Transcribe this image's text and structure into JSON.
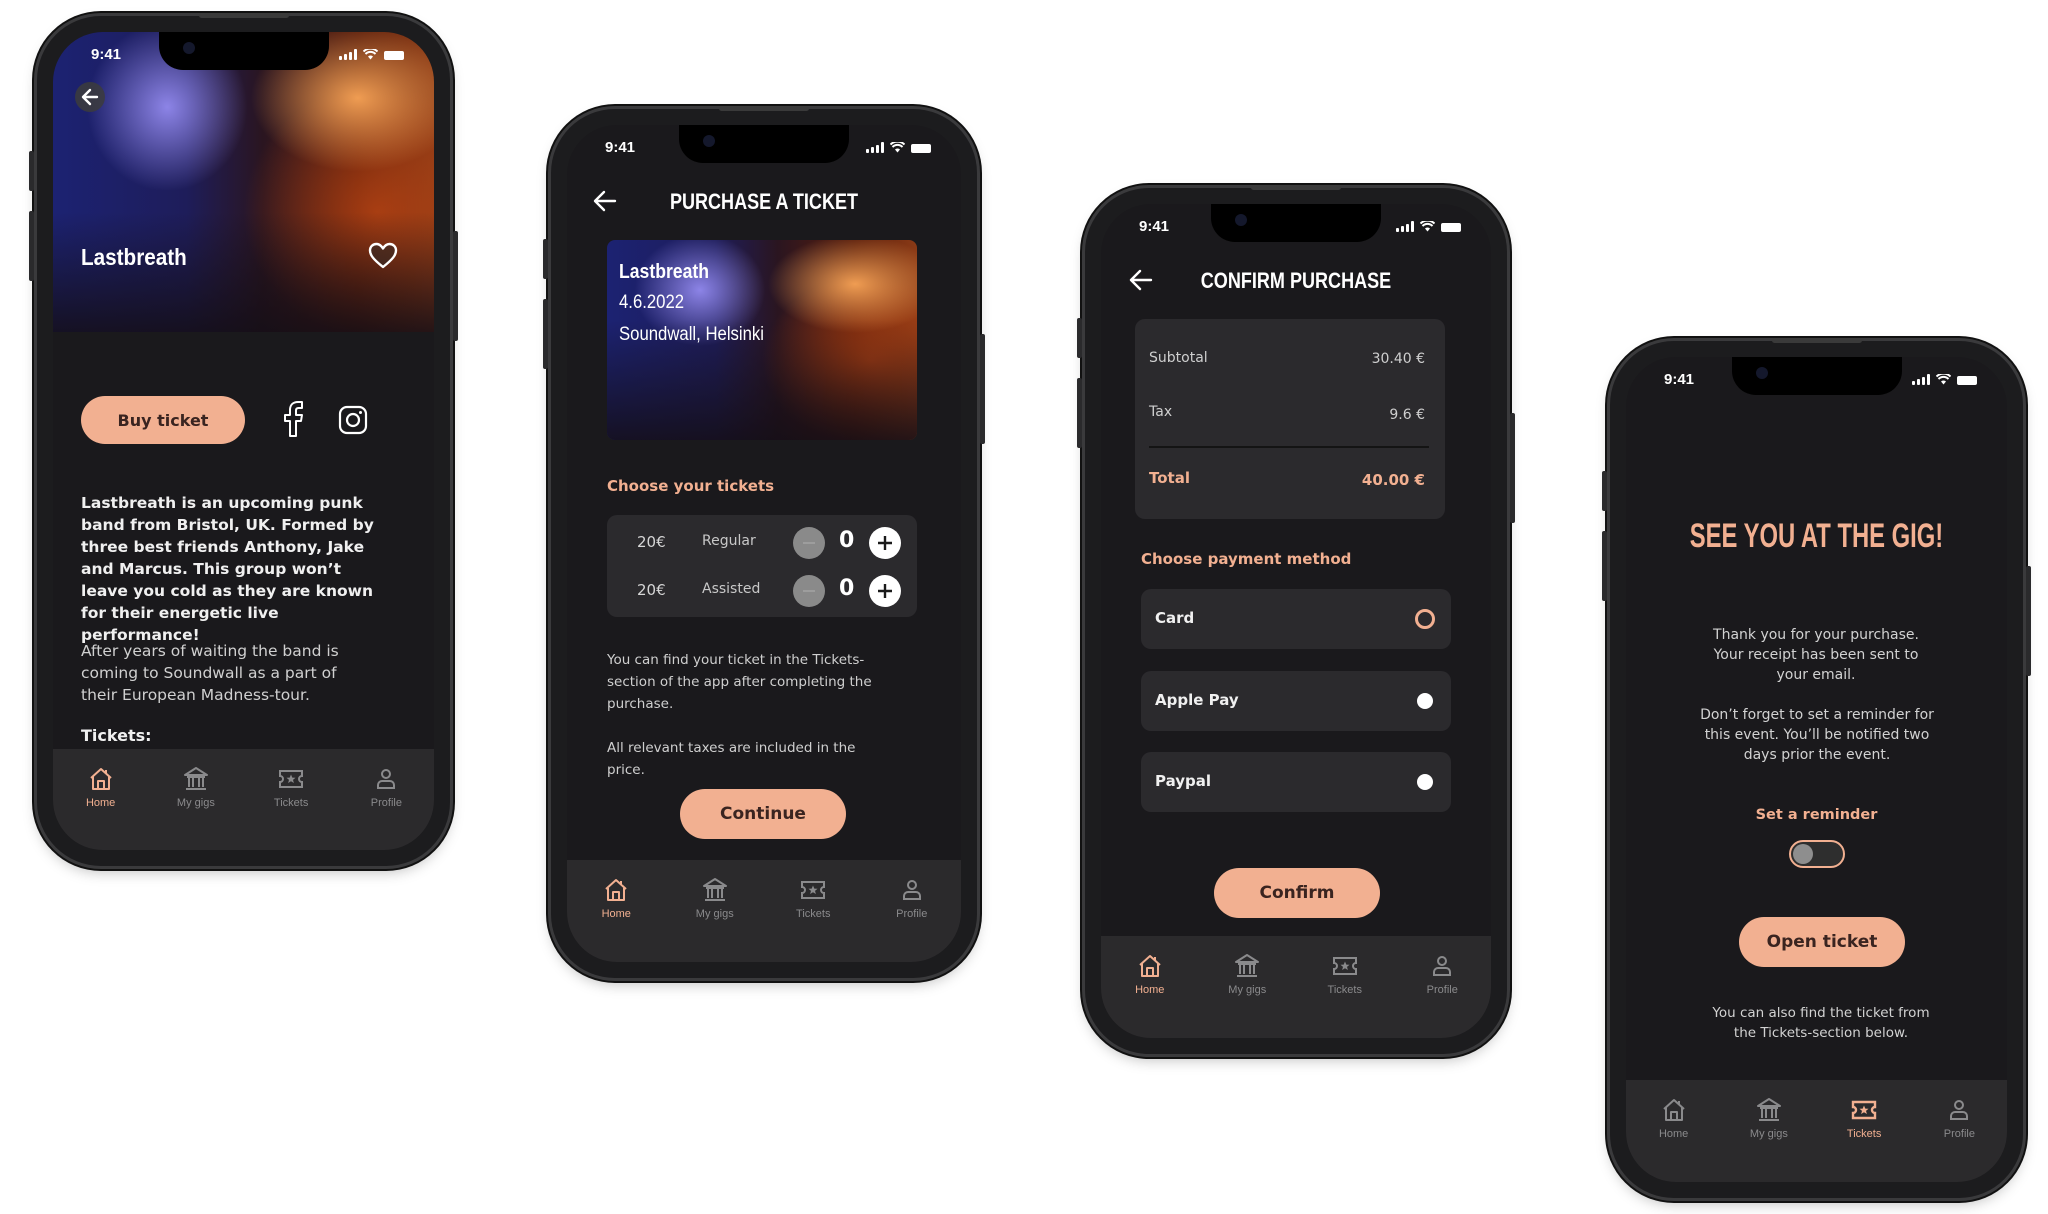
{
  "accent_color": "#f2b091",
  "background_color": "#1a191c",
  "status_bar": {
    "time": "9:41"
  },
  "nav": {
    "items": [
      {
        "label": "Home",
        "icon": "home-icon"
      },
      {
        "label": "My gigs",
        "icon": "venue-icon"
      },
      {
        "label": "Tickets",
        "icon": "ticket-icon"
      },
      {
        "label": "Profile",
        "icon": "profile-icon"
      }
    ]
  },
  "screen1": {
    "band_name": "Lastbreath",
    "buy_button": "Buy ticket",
    "description_bold": "Lastbreath is an upcoming punk band from Bristol, UK. Formed by three best friends Anthony, Jake and Marcus. This group won’t leave you cold as they are known for their energetic live performance!",
    "description": "After years of waiting the band is coming to Soundwall as a part of their European Madness-tour.",
    "tickets_heading": "Tickets:",
    "active_nav": "Home"
  },
  "screen2": {
    "title": "PURCHASE A TICKET",
    "event": {
      "name": "Lastbreath",
      "date": "4.6.2022",
      "venue": "Soundwall, Helsinki"
    },
    "section_label": "Choose your tickets",
    "tickets": [
      {
        "price": "20€",
        "type": "Regular",
        "quantity": "0"
      },
      {
        "price": "20€",
        "type": "Assisted",
        "quantity": "0"
      }
    ],
    "info1": "You can find your ticket in the Tickets-section of the app after completing the purchase.",
    "info2": "All relevant taxes are included in the price.",
    "continue_button": "Continue",
    "active_nav": "Home"
  },
  "screen3": {
    "title": "CONFIRM PURCHASE",
    "summary": {
      "subtotal_label": "Subtotal",
      "subtotal_value": "30.40 €",
      "tax_label": "Tax",
      "tax_value": "9.6 €",
      "total_label": "Total",
      "total_value": "40.00 €"
    },
    "section_label": "Choose payment method",
    "payment_methods": [
      {
        "label": "Card",
        "selected": true
      },
      {
        "label": "Apple Pay",
        "selected": false
      },
      {
        "label": "Paypal",
        "selected": false
      }
    ],
    "confirm_button": "Confirm",
    "active_nav": "Home"
  },
  "screen4": {
    "heading": "SEE YOU AT THE GIG!",
    "message1": "Thank you for your purchase. Your receipt has been sent to your email.",
    "message2": "Don’t forget to set a reminder for this event. You’ll be notified two days prior the event.",
    "reminder_label": "Set a reminder",
    "reminder_on": false,
    "open_ticket_button": "Open ticket",
    "footer_note": "You can also find the ticket from the Tickets-section below.",
    "active_nav": "Tickets"
  }
}
